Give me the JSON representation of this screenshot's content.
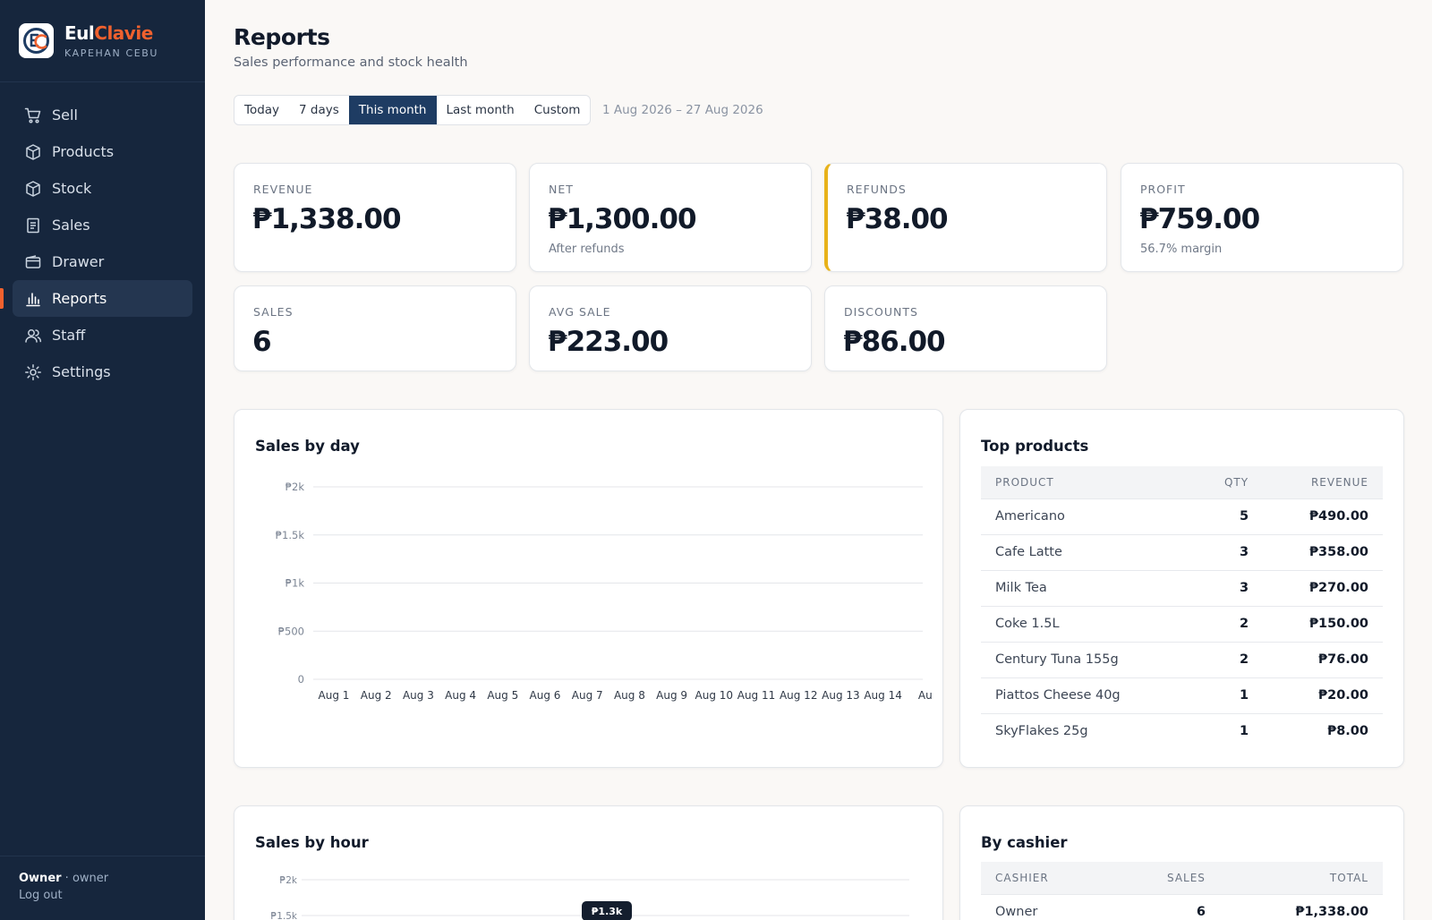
{
  "brand": {
    "name_part1": "Eul",
    "name_part2": "Clavie",
    "subtitle": "KAPEHAN CEBU"
  },
  "nav": [
    {
      "label": "Sell",
      "icon": "cart-icon"
    },
    {
      "label": "Products",
      "icon": "box-icon"
    },
    {
      "label": "Stock",
      "icon": "box-icon"
    },
    {
      "label": "Sales",
      "icon": "receipt-icon"
    },
    {
      "label": "Drawer",
      "icon": "wallet-icon"
    },
    {
      "label": "Reports",
      "icon": "bar-chart-icon",
      "active": true
    },
    {
      "label": "Staff",
      "icon": "users-icon"
    },
    {
      "label": "Settings",
      "icon": "sun-gear-icon"
    }
  ],
  "footer": {
    "user": "Owner",
    "separator": " · ",
    "role": "owner",
    "logout": "Log out"
  },
  "page": {
    "title": "Reports",
    "subtitle": "Sales performance and stock health"
  },
  "range_tabs": [
    "Today",
    "7 days",
    "This month",
    "Last month",
    "Custom"
  ],
  "range_active": "This month",
  "range_text": "1 Aug 2026 – 27 Aug 2026",
  "stats": {
    "revenue": {
      "label": "REVENUE",
      "value": "₱1,338.00"
    },
    "net": {
      "label": "NET",
      "value": "₱1,300.00",
      "note": "After refunds"
    },
    "refunds": {
      "label": "REFUNDS",
      "value": "₱38.00"
    },
    "profit": {
      "label": "PROFIT",
      "value": "₱759.00",
      "note": "56.7% margin"
    },
    "sales": {
      "label": "SALES",
      "value": "6"
    },
    "avg": {
      "label": "AVG SALE",
      "value": "₱223.00"
    },
    "discounts": {
      "label": "DISCOUNTS",
      "value": "₱86.00"
    }
  },
  "sales_by_day": {
    "title": "Sales by day"
  },
  "top_products": {
    "title": "Top products",
    "headers": [
      "PRODUCT",
      "QTY",
      "REVENUE"
    ],
    "rows": [
      [
        "Americano",
        "5",
        "₱490.00"
      ],
      [
        "Cafe Latte",
        "3",
        "₱358.00"
      ],
      [
        "Milk Tea",
        "3",
        "₱270.00"
      ],
      [
        "Coke 1.5L",
        "2",
        "₱150.00"
      ],
      [
        "Century Tuna 155g",
        "2",
        "₱76.00"
      ],
      [
        "Piattos Cheese 40g",
        "1",
        "₱20.00"
      ],
      [
        "SkyFlakes 25g",
        "1",
        "₱8.00"
      ]
    ]
  },
  "sales_by_hour": {
    "title": "Sales by hour",
    "tooltip": "₱1.3k"
  },
  "by_cashier": {
    "title": "By cashier",
    "headers": [
      "CASHIER",
      "SALES",
      "TOTAL"
    ],
    "rows": [
      [
        "Owner",
        "6",
        "₱1,338.00"
      ]
    ]
  },
  "chart_data": [
    {
      "type": "bar",
      "categories": [
        "Aug 1",
        "Aug 2",
        "Aug 3",
        "Aug 4",
        "Aug 5",
        "Aug 6",
        "Aug 7",
        "Aug 8",
        "Aug 9",
        "Aug 10",
        "Aug 11",
        "Aug 12",
        "Aug 13",
        "Aug 14",
        "Au"
      ],
      "values": [
        0,
        0,
        0,
        0,
        0,
        0,
        0,
        0,
        0,
        0,
        0,
        0,
        0,
        0,
        0
      ],
      "title": "Sales by day",
      "ytick_labels": [
        "0",
        "₱500",
        "₱1k",
        "₱1.5k",
        "₱2k"
      ],
      "ylim": [
        0,
        2000
      ],
      "grid": true
    },
    {
      "type": "bar",
      "title": "Sales by hour",
      "ytick_labels": [
        "₱1.5k",
        "₱2k"
      ],
      "ylim": [
        0,
        2000
      ],
      "annotation": "₱1.3k",
      "grid": true
    }
  ],
  "colors": {
    "sidebar": "#16263d",
    "accent": "#f0612e",
    "active_tab": "#1e3c63",
    "refund_border": "#e8b21a"
  }
}
